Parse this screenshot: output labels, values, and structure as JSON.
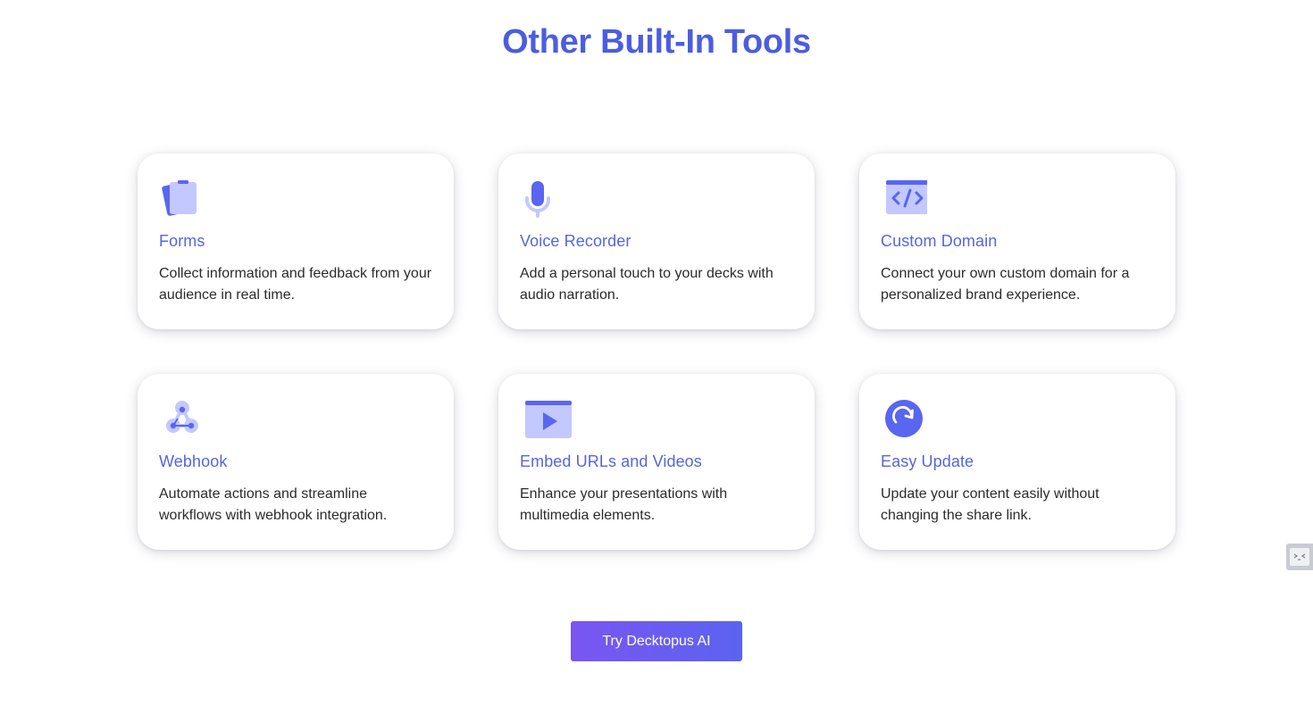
{
  "section": {
    "title": "Other Built-In Tools"
  },
  "cards": [
    {
      "icon": "clipboard-icon",
      "title": "Forms",
      "description": "Collect information and feedback from your audience in real time."
    },
    {
      "icon": "microphone-icon",
      "title": "Voice Recorder",
      "description": "Add a personal touch to your decks with audio narration."
    },
    {
      "icon": "code-window-icon",
      "title": "Custom Domain",
      "description": "Connect your own custom domain for a personalized brand experience."
    },
    {
      "icon": "webhook-icon",
      "title": "Webhook",
      "description": "Automate actions and streamline workflows with webhook integration."
    },
    {
      "icon": "video-play-icon",
      "title": "Embed URLs and Videos",
      "description": "Enhance your presentations with multimedia elements."
    },
    {
      "icon": "refresh-icon",
      "title": "Easy Update",
      "description": "Update your content easily without changing the share link."
    }
  ],
  "cta": {
    "label": "Try Decktopus AI"
  },
  "colors": {
    "accent": "#4b5de0",
    "icon_primary": "#5866f0",
    "icon_light": "#c3c8ff",
    "button_gradient_start": "#7a55f2",
    "button_gradient_end": "#5b63f0"
  }
}
